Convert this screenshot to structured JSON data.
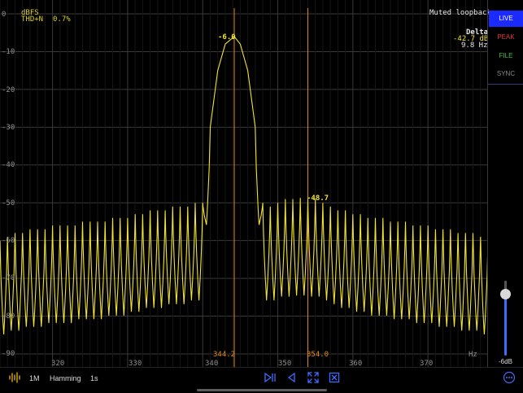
{
  "header": {
    "unit_label": "dBFS",
    "thd_label": "THD+N",
    "thd_value": "0.7%",
    "source_label": "Muted loopback"
  },
  "delta": {
    "title": "Delta",
    "db": "-42.7 dB",
    "hz": "9.8 Hz"
  },
  "y_axis": {
    "ticks": [
      "0",
      "-10",
      "-20",
      "-30",
      "-40",
      "-50",
      "-60",
      "-70",
      "-80",
      "-90"
    ]
  },
  "x_axis": {
    "ticks": [
      "320",
      "330",
      "340",
      "350",
      "360",
      "370"
    ],
    "unit": "Hz"
  },
  "peaks": {
    "main": "-6.0",
    "secondary": "-48.7"
  },
  "cursors": {
    "left": "344.2",
    "right": "354.0"
  },
  "sidebar": {
    "live": "LIVE",
    "peak": "PEAK",
    "file": "FILE",
    "sync": "SYNC",
    "gain_label": "-6dB",
    "gain_level_percent": 83
  },
  "toolbar": {
    "fft_size": "1M",
    "window": "Hamming",
    "averaging": "1s"
  },
  "colors": {
    "trace": "#f2e233",
    "cursor": "#e28a1e",
    "live_active": "#1b2bff",
    "peak": "#e03a3a",
    "file": "#38c83a",
    "accent": "#3d6cff"
  },
  "chart_data": {
    "type": "line",
    "ylabel": "dBFS",
    "xlabel": "Hz",
    "xlim": [
      313,
      378
    ],
    "ylim": [
      -90,
      0
    ],
    "grid": true,
    "series": [
      {
        "x": [
          313,
          314,
          315,
          316,
          317,
          318,
          319,
          320,
          321,
          322,
          323,
          324,
          325,
          326,
          327,
          328,
          329,
          330,
          331,
          332,
          333,
          334,
          335,
          336,
          337,
          338,
          339,
          340,
          341,
          342,
          343,
          344.2,
          345,
          346,
          347,
          348,
          349,
          350,
          351,
          352,
          353,
          354,
          355,
          356,
          357,
          358,
          359,
          360,
          361,
          362,
          363,
          364,
          365,
          366,
          367,
          368,
          369,
          370,
          371,
          372,
          373,
          374,
          375,
          376,
          377,
          378
        ],
        "y": [
          -60,
          -59,
          -58,
          -58,
          -57,
          -57,
          -57,
          -56,
          -56,
          -56,
          -56,
          -55,
          -55,
          -55,
          -55,
          -54,
          -54,
          -54,
          -53,
          -53,
          -52,
          -52,
          -52,
          -51,
          -51,
          -51,
          -50,
          -50,
          -30,
          -15,
          -8,
          -6,
          -8,
          -15,
          -30,
          -50,
          -51,
          -50,
          -49,
          -49,
          -48.7,
          -49,
          -49,
          -50,
          -51,
          -52,
          -52,
          -53,
          -53,
          -54,
          -54,
          -54,
          -55,
          -55,
          -55,
          -56,
          -56,
          -56,
          -57,
          -57,
          -57,
          -58,
          -58,
          -58,
          -59,
          -60
        ]
      }
    ],
    "annotations": [
      "-6.0",
      "-48.7",
      "344.2",
      "354.0"
    ]
  }
}
